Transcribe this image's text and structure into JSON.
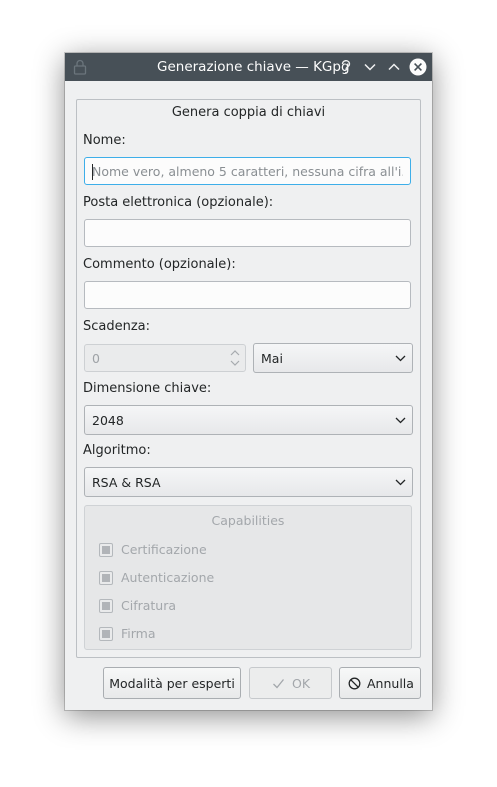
{
  "window": {
    "title": "Generazione chiave — KGpg",
    "controls": [
      "help-icon",
      "minimize-icon",
      "maximize-icon",
      "close-icon"
    ]
  },
  "group": {
    "title": "Genera coppia di chiavi"
  },
  "form": {
    "name_label": "Nome:",
    "name_placeholder": "Nome vero, almeno 5 caratteri, nessuna cifra all'i...",
    "name_value": "",
    "email_label": "Posta elettronica (opzionale):",
    "email_value": "",
    "comment_label": "Commento (opzionale):",
    "comment_value": "",
    "expiry_label": "Scadenza:",
    "expiry_value": "0",
    "expiry_unit": "Mai",
    "keysize_label": "Dimensione chiave:",
    "keysize_value": "2048",
    "algorithm_label": "Algoritmo:",
    "algorithm_value": "RSA & RSA"
  },
  "capabilities": {
    "title": "Capabilities",
    "items": [
      {
        "label": "Certificazione",
        "checked": "partial"
      },
      {
        "label": "Autenticazione",
        "checked": "partial"
      },
      {
        "label": "Cifratura",
        "checked": "partial"
      },
      {
        "label": "Firma",
        "checked": "partial"
      }
    ]
  },
  "buttons": {
    "expert": "Modalità per esperti",
    "ok": "OK",
    "cancel": "Annulla"
  },
  "colors": {
    "titlebar": "#475057",
    "window_bg": "#eff0f1",
    "focus": "#3daee9",
    "disabled_text": "#a3a7ab"
  }
}
